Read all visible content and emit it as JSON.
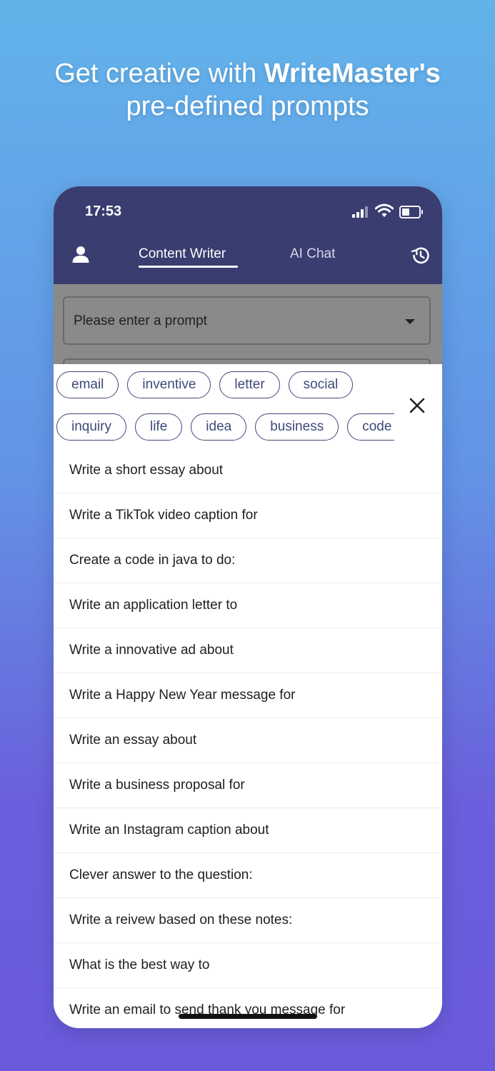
{
  "headline": {
    "prefix": "Get creative with ",
    "brand": "WriteMaster's",
    "line2": "pre-defined prompts"
  },
  "status_bar": {
    "time": "17:53"
  },
  "app_bar": {
    "tabs": [
      {
        "label": "Content Writer",
        "active": true
      },
      {
        "label": "AI Chat",
        "active": false
      }
    ]
  },
  "prompt_select": {
    "placeholder": "Please enter a prompt"
  },
  "tags": {
    "row1": [
      "email",
      "inventive",
      "letter",
      "social"
    ],
    "row2": [
      "inquiry",
      "life",
      "idea",
      "business",
      "code"
    ]
  },
  "prompts": [
    "Write a short essay about",
    "Write a TikTok video caption for",
    "Create a code in java to do:",
    "Write an application letter to",
    "Write a innovative ad about",
    "Write a Happy New Year message for",
    "Write an essay about",
    "Write a business proposal for",
    "Write an Instagram caption about",
    "Clever answer to the question:",
    "Write a reivew based on these notes:",
    "What is the best way to",
    "Write an email to send thank you message for"
  ],
  "colors": {
    "app_bar": "#393d70",
    "chip_border": "#3d4a78",
    "gradient_top": "#62b3ea",
    "gradient_bottom": "#6a5bdc"
  }
}
